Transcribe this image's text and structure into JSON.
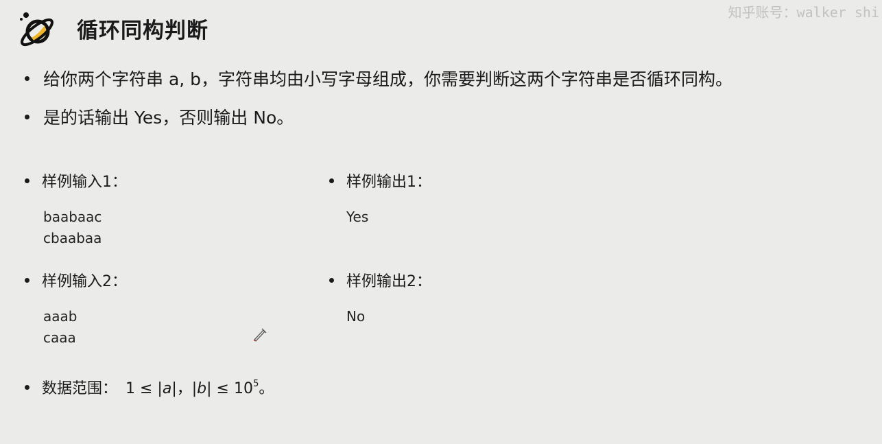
{
  "header": {
    "title": "循环同构判断",
    "watermark": "知乎账号：walker shi"
  },
  "bullets": {
    "problem": "给你两个字符串 a, b，字符串均由小写字母组成，你需要判断这两个字符串是否循环同构。",
    "output_rule": "是的话输出 Yes，否则输出 No。"
  },
  "samples": {
    "input1_label": "样例输入1：",
    "input1_value": "baabaac\ncbaabaa",
    "output1_label": "样例输出1：",
    "output1_value": "Yes",
    "input2_label": "样例输入2：",
    "input2_value": "aaab\ncaaa",
    "output2_label": "样例输出2：",
    "output2_value": "No"
  },
  "constraint": {
    "label": "数据范围：",
    "lead": "1 ≤ |",
    "var_a": "a",
    "mid": "|，|",
    "var_b": "b",
    "after": "| ≤ 10",
    "exponent": "5",
    "end": "。"
  }
}
